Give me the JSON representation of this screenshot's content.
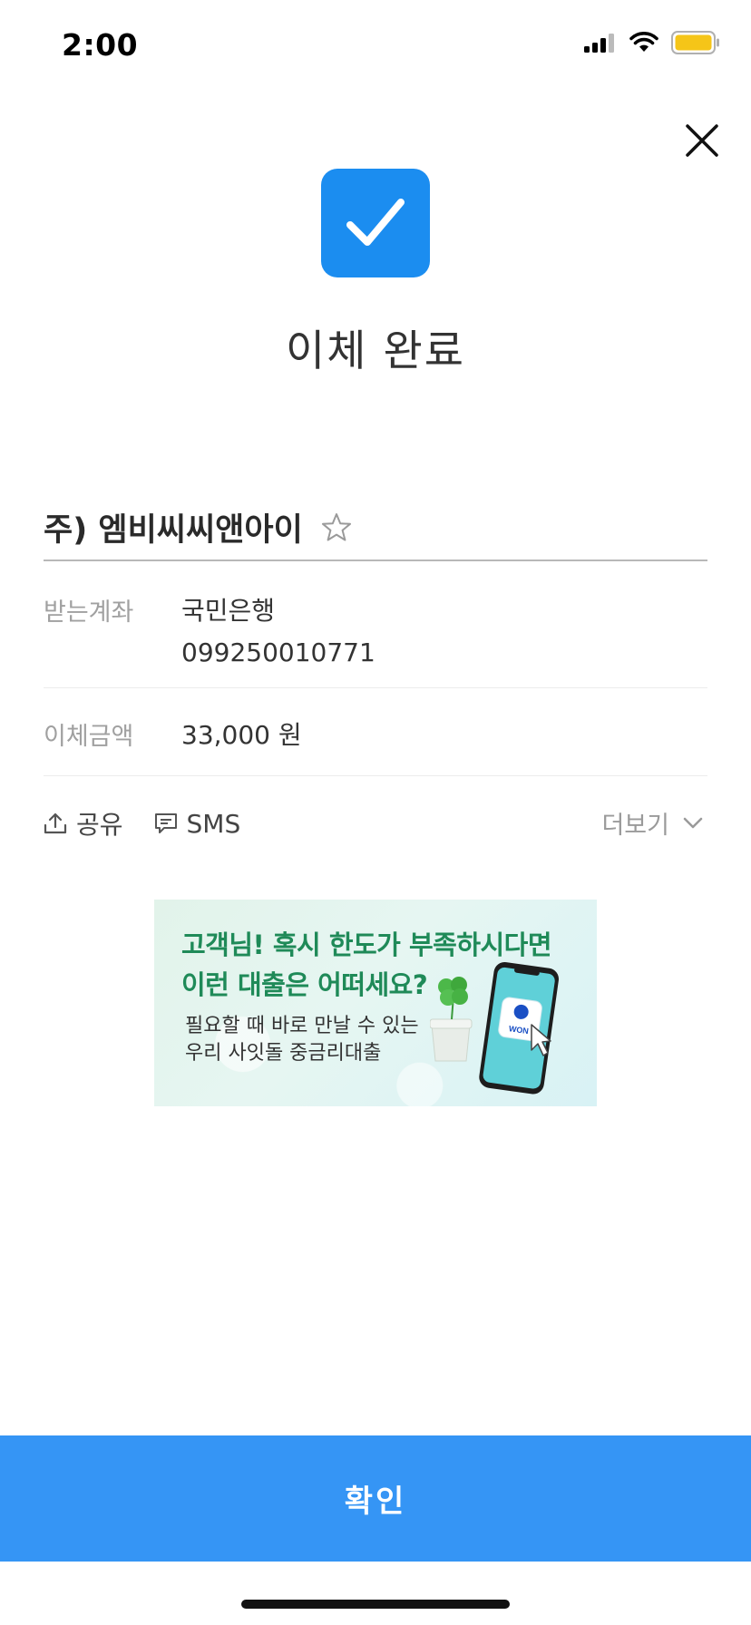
{
  "status_bar": {
    "time": "2:00",
    "battery_color": "#f5c518"
  },
  "header": {
    "title": "이체 완료",
    "close_icon": "close-icon",
    "check_icon": "checkbox-checked-icon",
    "accent": "#1b8df0"
  },
  "recipient": {
    "name": "주) 엠비씨씨앤아이",
    "favorite_icon": "star-outline-icon"
  },
  "details": {
    "account_label": "받는계좌",
    "bank": "국민은행",
    "account_number": "099250010771",
    "amount_label": "이체금액",
    "amount": "33,000 원"
  },
  "actions": {
    "share": "공유",
    "sms": "SMS",
    "more": "더보기"
  },
  "banner": {
    "headline_1": "고객님! 혹시 한도가 부족하시다면",
    "headline_2": "이런 대출은 어떠세요?",
    "sub_1": "필요할 때 바로 만날 수 있는",
    "sub_2": "우리 사잇돌 중금리대출",
    "app_badge": "WON",
    "headline_color": "#1f8a58"
  },
  "footer": {
    "confirm": "확인",
    "button_color": "#3595f5"
  }
}
